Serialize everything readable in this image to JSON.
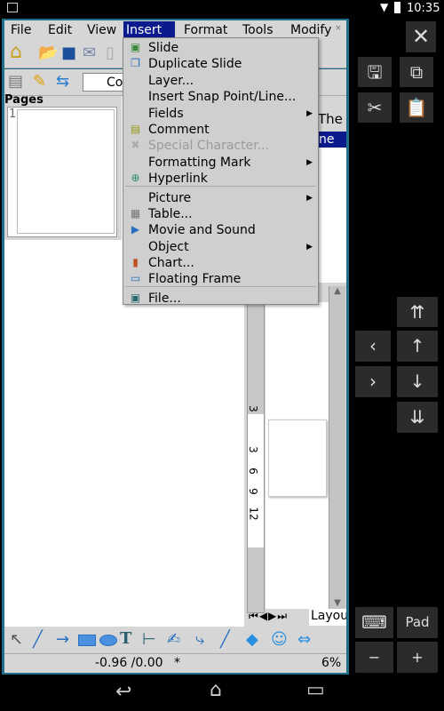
{
  "status_bar": {
    "time": "10:35"
  },
  "menubar": {
    "items": [
      "File",
      "Edit",
      "View",
      "Insert",
      "Format",
      "Tools",
      "Modify"
    ],
    "active": "Insert"
  },
  "toolbar2": {
    "line_style_value": "Co"
  },
  "pages_pane": {
    "title": "Pages",
    "page_number": "1"
  },
  "insert_menu": {
    "items": [
      {
        "label": "Slide",
        "icon": "slide-icon",
        "submenu": false,
        "disabled": false
      },
      {
        "label": "Duplicate Slide",
        "icon": "duplicate-slide-icon",
        "submenu": false,
        "disabled": false
      },
      {
        "label": "Layer...",
        "icon": "",
        "submenu": false,
        "disabled": false
      },
      {
        "label": "Insert Snap Point/Line...",
        "icon": "",
        "submenu": false,
        "disabled": false
      },
      {
        "label": "Fields",
        "icon": "",
        "submenu": true,
        "disabled": false
      },
      {
        "label": "Comment",
        "icon": "comment-icon",
        "submenu": false,
        "disabled": false
      },
      {
        "label": "Special Character...",
        "icon": "special-character-icon",
        "submenu": false,
        "disabled": true
      },
      {
        "label": "Formatting Mark",
        "icon": "",
        "submenu": true,
        "disabled": false
      },
      {
        "label": "Hyperlink",
        "icon": "hyperlink-icon",
        "submenu": false,
        "disabled": false
      },
      {
        "label": "Picture",
        "icon": "",
        "submenu": true,
        "disabled": false
      },
      {
        "label": "Table...",
        "icon": "table-icon",
        "submenu": false,
        "disabled": false
      },
      {
        "label": "Movie and Sound",
        "icon": "movie-icon",
        "submenu": false,
        "disabled": false
      },
      {
        "label": "Object",
        "icon": "",
        "submenu": true,
        "disabled": false
      },
      {
        "label": "Chart...",
        "icon": "chart-icon",
        "submenu": false,
        "disabled": false
      },
      {
        "label": "Floating Frame",
        "icon": "floating-frame-icon",
        "submenu": false,
        "disabled": false
      },
      {
        "label": "File...",
        "icon": "file-icon",
        "submenu": false,
        "disabled": false
      }
    ]
  },
  "side_panel": {
    "tab_label": "The",
    "selected_item": "ne"
  },
  "ruler": {
    "labels": [
      "3",
      "3",
      "6",
      "9",
      "12"
    ]
  },
  "layout_tab": {
    "label": "Layou"
  },
  "statusbar": {
    "position": "-0.96 /0.00",
    "modified": "*",
    "zoom": "6%"
  },
  "right_pad": {
    "pad_label": "Pad",
    "minus": "−",
    "plus": "+"
  },
  "colors": {
    "menu_highlight": "#0b1a8c",
    "window_border": "#1f6f8b"
  }
}
